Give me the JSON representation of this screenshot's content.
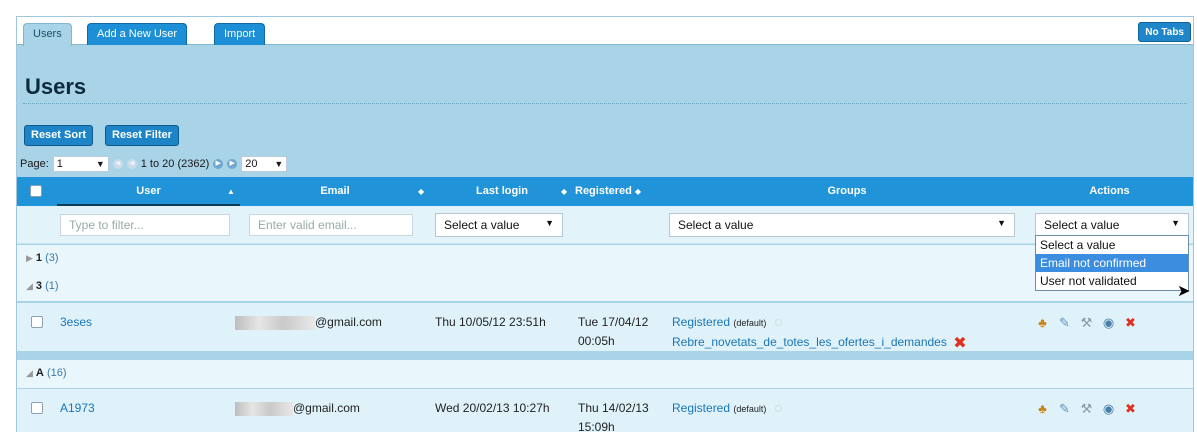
{
  "tabs": [
    {
      "label": "Users",
      "active": true
    },
    {
      "label": "Add a New User",
      "active": false
    },
    {
      "label": "Import",
      "active": false
    }
  ],
  "no_tabs_label": "No Tabs",
  "page_title": "Users",
  "buttons": {
    "reset_sort": "Reset Sort",
    "reset_filter": "Reset Filter"
  },
  "pager": {
    "label": "Page:",
    "current_page": "1",
    "range": "1 to 20 (2362)",
    "page_size": "20"
  },
  "columns": {
    "user": "User",
    "email": "Email",
    "last_login": "Last login",
    "registered": "Registered",
    "groups": "Groups",
    "actions": "Actions"
  },
  "filters": {
    "user_placeholder": "Type to filter...",
    "email_placeholder": "Enter valid email...",
    "last_login_select": "Select a value",
    "groups_select": "Select a value",
    "actions_select": "Select a value"
  },
  "actions_dropdown_options": [
    "Select a value",
    "Email not confirmed",
    "User not validated"
  ],
  "groups": [
    {
      "label": "1",
      "count": "(3)",
      "expanded": false
    },
    {
      "label": "3",
      "count": "(1)",
      "expanded": true
    },
    {
      "label": "A",
      "count": "(16)",
      "expanded": true
    }
  ],
  "rows": [
    {
      "user": "3eses",
      "email_suffix": "@gmail.com",
      "last_login": "Thu 10/05/12 23:51h",
      "registered_date": "Tue 17/04/12",
      "registered_time": "00:05h",
      "groups": [
        {
          "name": "Registered",
          "tag": "(default)"
        },
        {
          "name": "Rebre_novetats_de_totes_les_ofertes_i_demandes",
          "tag": ""
        }
      ]
    },
    {
      "user": "A1973",
      "email_suffix": "@gmail.com",
      "last_login": "Wed 20/02/13 10:27h",
      "registered_date": "Thu 14/02/13",
      "registered_time": "15:09h",
      "groups": [
        {
          "name": "Registered",
          "tag": "(default)"
        }
      ]
    }
  ],
  "icons": {
    "nav_first": "first-page-icon",
    "nav_prev": "prev-page-icon",
    "nav_next": "next-page-icon",
    "nav_last": "last-page-icon",
    "row_actions": [
      "users-icon",
      "edit-icon",
      "tools-icon",
      "lifebuoy-icon",
      "delete-icon"
    ]
  },
  "colors": {
    "header_blue": "#2193d9",
    "panel_blue": "#a9d3e7",
    "link_blue": "#1a76b8",
    "delete_red": "#e0301e",
    "dropdown_highlight": "#3b8de0"
  }
}
